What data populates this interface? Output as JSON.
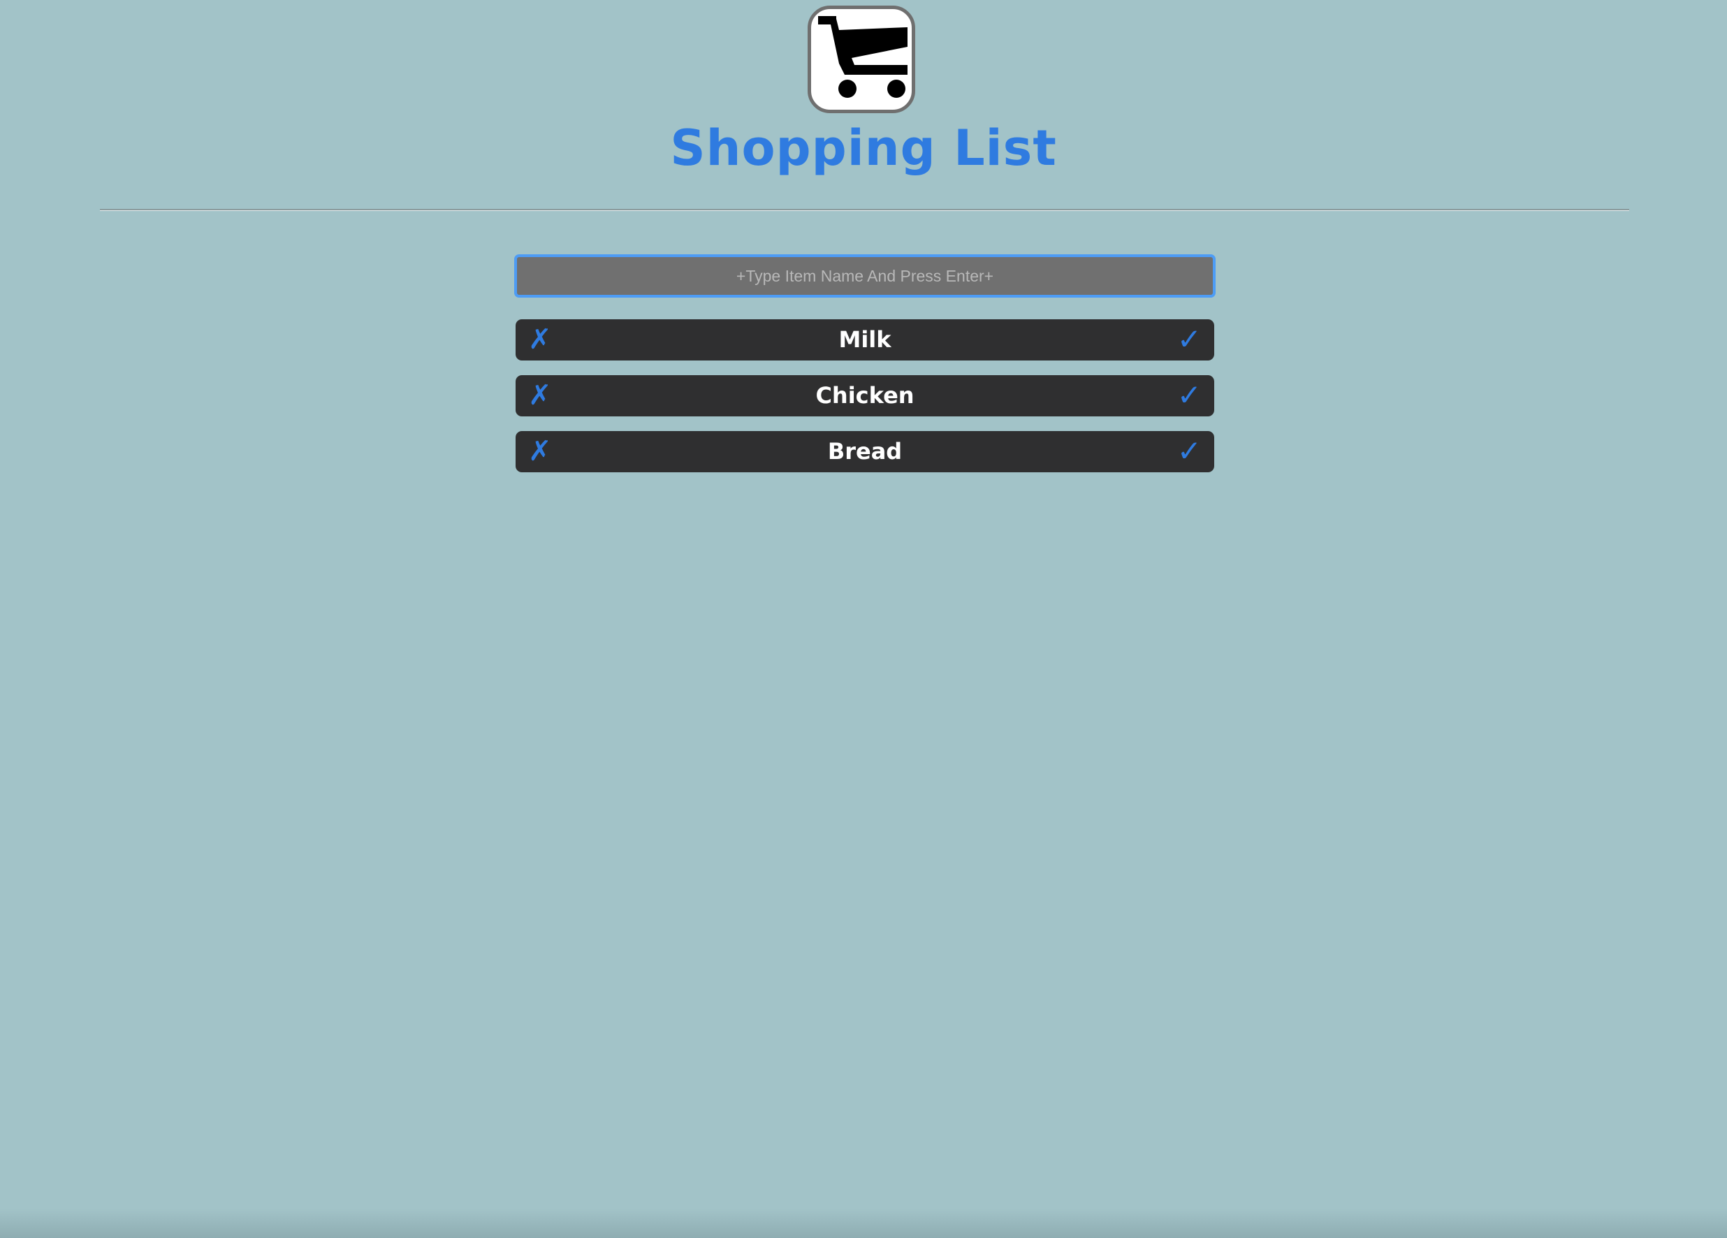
{
  "header": {
    "logo_icon": "shopping-cart-icon",
    "title": "Shopping List"
  },
  "input": {
    "placeholder": "+Type Item Name And Press Enter+",
    "value": ""
  },
  "items": [
    {
      "name": "Milk",
      "remove_icon": "✗",
      "done_icon": "✓"
    },
    {
      "name": "Chicken",
      "remove_icon": "✗",
      "done_icon": "✓"
    },
    {
      "name": "Bread",
      "remove_icon": "✗",
      "done_icon": "✓"
    }
  ],
  "colors": {
    "background": "#a2c3c8",
    "accent": "#2f7be0",
    "item_background": "#2f2f30",
    "input_background": "#707070",
    "input_focus_border": "#4d9cf5"
  }
}
